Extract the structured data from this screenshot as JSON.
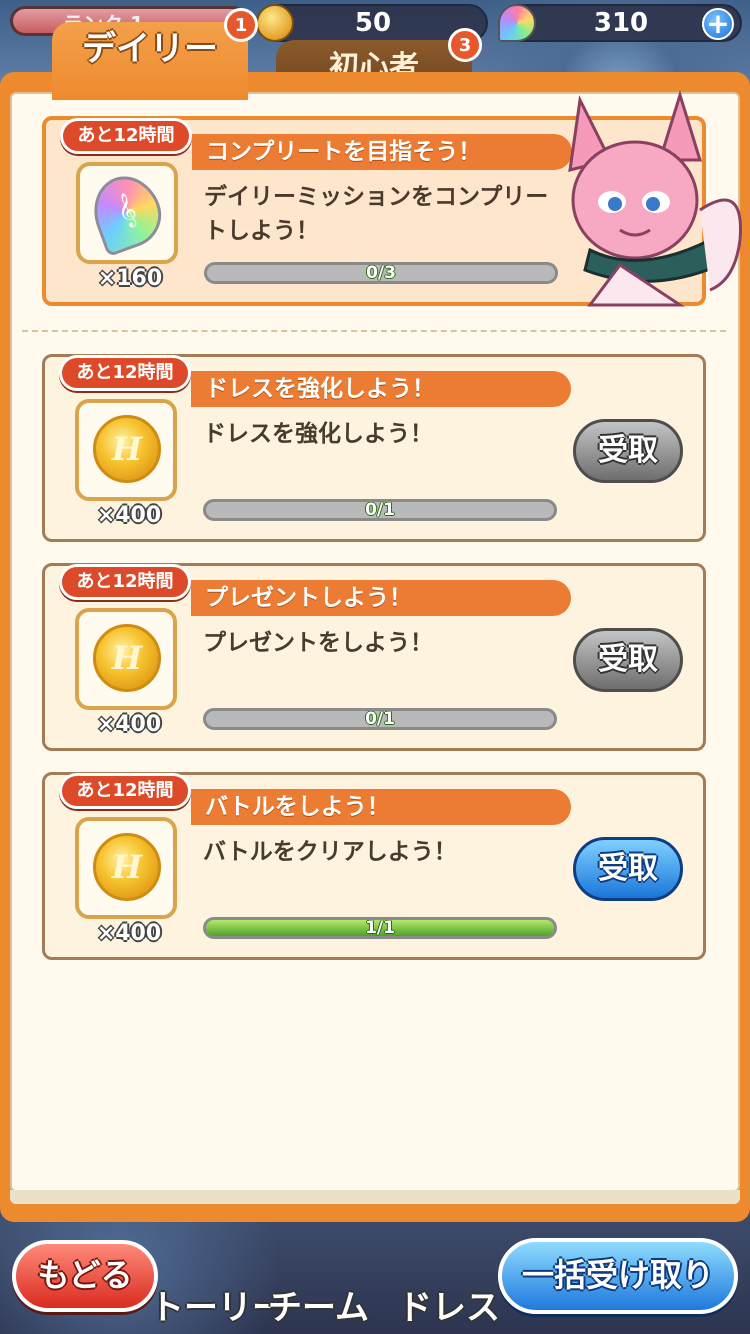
{
  "topbar": {
    "rank_label": "ランク 1",
    "coins": "50",
    "gems": "310",
    "plus": "+"
  },
  "tabs": [
    {
      "label": "デイリー",
      "badge": "1",
      "active": true
    },
    {
      "label": "初心者",
      "badge": "3",
      "active": false
    }
  ],
  "missions": [
    {
      "time_left": "あと12時間",
      "title": "コンプリートを目指そう！",
      "description": "デイリーミッションをコンプリートしよう！",
      "reward_icon": "rainbow-gem-icon",
      "reward_qty": "×160",
      "progress_text": "0/3",
      "progress": 0,
      "featured": true
    },
    {
      "time_left": "あと12時間",
      "title": "ドレスを強化しよう！",
      "description": "ドレスを強化しよう！",
      "reward_icon": "gold-coin-icon",
      "reward_qty": "×400",
      "progress_text": "0/1",
      "progress": 0,
      "button": "受取",
      "button_state": "disabled"
    },
    {
      "time_left": "あと12時間",
      "title": "プレゼントしよう！",
      "description": "プレゼントをしよう！",
      "reward_icon": "gold-coin-icon",
      "reward_qty": "×400",
      "progress_text": "0/1",
      "progress": 0,
      "button": "受取",
      "button_state": "disabled"
    },
    {
      "time_left": "あと12時間",
      "title": "バトルをしよう！",
      "description": "バトルをクリアしよう！",
      "reward_icon": "gold-coin-icon",
      "reward_qty": "×400",
      "progress_text": "1/1",
      "progress": 1,
      "button": "受取",
      "button_state": "active"
    }
  ],
  "bottom_nav": {
    "back": "もどる",
    "story": "トーリー",
    "team": "チーム",
    "dress": "ドレス",
    "claim_all": "一括受け取り"
  },
  "colors": {
    "accent_orange": "#ee8a2e",
    "title_bar": "#ec7c33",
    "time_badge": "#dd4a2a",
    "active_button": "#1b76d9",
    "back_button": "#d92c20",
    "progress_green": "#4fa226"
  }
}
